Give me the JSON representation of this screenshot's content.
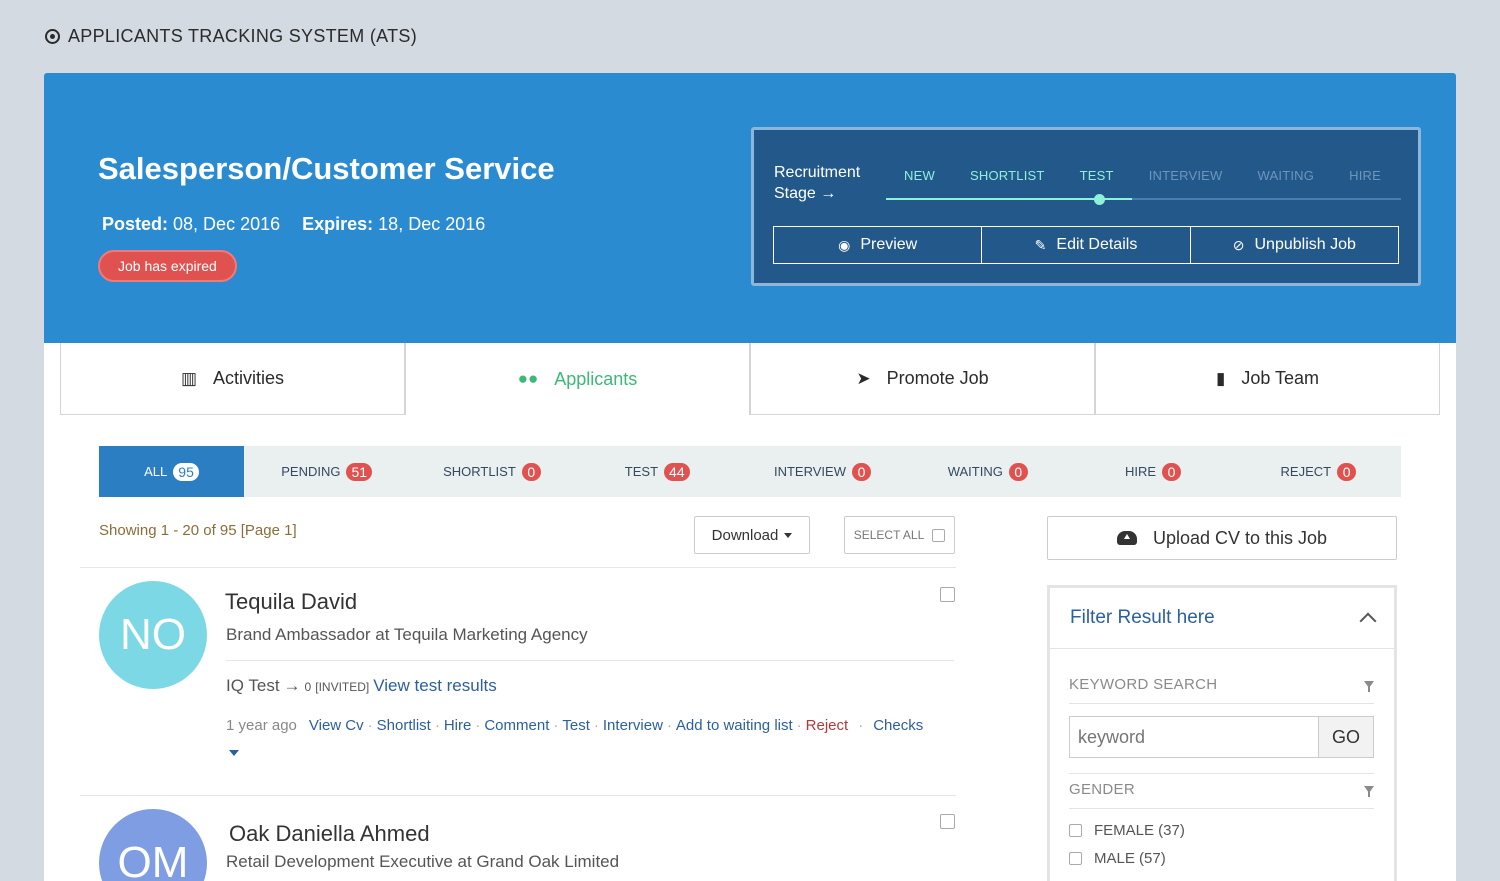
{
  "app": {
    "title": "APPLICANTS TRACKING SYSTEM (ATS)"
  },
  "job": {
    "title": "Salesperson/Customer Service",
    "posted_label": "Posted:",
    "posted": "08, Dec 2016",
    "expires_label": "Expires:",
    "expires": "18, Dec 2016",
    "status_badge": "Job has expired"
  },
  "recruitment": {
    "label_line1": "Recruitment",
    "label_line2": "Stage",
    "arrow": "→",
    "stages": [
      {
        "label": "NEW",
        "state": "active"
      },
      {
        "label": "SHORTLIST",
        "state": "active"
      },
      {
        "label": "TEST",
        "state": "active"
      },
      {
        "label": "INTERVIEW",
        "state": "inactive"
      },
      {
        "label": "WAITING",
        "state": "inactive"
      },
      {
        "label": "HIRE",
        "state": "inactive"
      }
    ],
    "actions": {
      "preview": "Preview",
      "edit": "Edit Details",
      "unpublish": "Unpublish Job"
    }
  },
  "main_tabs": [
    {
      "label": "Activities",
      "icon": "bar-chart-icon"
    },
    {
      "label": "Applicants",
      "icon": "users-icon",
      "active": true
    },
    {
      "label": "Promote Job",
      "icon": "paper-plane-icon"
    },
    {
      "label": "Job Team",
      "icon": "building-icon"
    }
  ],
  "status_tabs": [
    {
      "label": "ALL",
      "count": "95",
      "active": true
    },
    {
      "label": "PENDING",
      "count": "51"
    },
    {
      "label": "SHORTLIST",
      "count": "0"
    },
    {
      "label": "TEST",
      "count": "44"
    },
    {
      "label": "INTERVIEW",
      "count": "0"
    },
    {
      "label": "WAITING",
      "count": "0"
    },
    {
      "label": "HIRE",
      "count": "0"
    },
    {
      "label": "REJECT",
      "count": "0"
    }
  ],
  "list": {
    "showing": "Showing 1 - 20 of 95 [Page 1]",
    "download": "Download",
    "select_all": "SELECT ALL"
  },
  "candidates": [
    {
      "initials": "NO",
      "name": "Tequila David",
      "role": "Brand Ambassador at Tequila Marketing Agency",
      "avatar_color": "#7dd8e6",
      "test_name": "IQ Test",
      "test_arrow": "→",
      "test_score": "0",
      "test_status": "[INVITED]",
      "test_link": "View test results",
      "time": "1 year ago",
      "actions": [
        "View Cv",
        "Shortlist",
        "Hire",
        "Comment",
        "Test",
        "Interview",
        "Add to waiting list"
      ],
      "reject": "Reject",
      "checks": "Checks"
    },
    {
      "initials": "OM",
      "name": "Oak Daniella Ahmed",
      "role": "Retail Development Executive at Grand Oak Limited",
      "avatar_color": "#7f9de3"
    }
  ],
  "sidebar": {
    "upload": "Upload CV to this Job",
    "filter_title": "Filter Result here",
    "keyword_label": "KEYWORD SEARCH",
    "keyword_placeholder": "keyword",
    "go": "GO",
    "gender_label": "GENDER",
    "gender_options": [
      "FEMALE (37)",
      "MALE (57)"
    ]
  }
}
